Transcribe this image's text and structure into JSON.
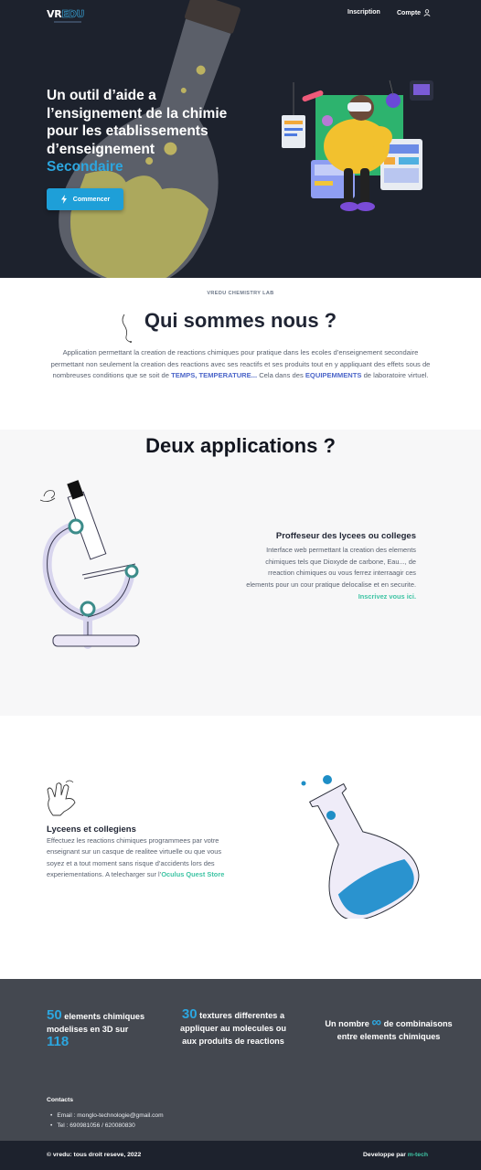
{
  "header": {
    "logo_vr": "VR",
    "logo_edu": "EDU",
    "nav": {
      "inscription": "Inscription",
      "compte": "Compte"
    }
  },
  "hero": {
    "title_line1": "Un outil d’aide a",
    "title_line2": "l’ensignement de la chimie",
    "title_line3": "pour les etablissements",
    "title_line4": "d’enseignement",
    "title_accent": "Secondaire",
    "cta_label": "Commencer"
  },
  "about": {
    "kicker": "VREDU  CHEMISTRY LAB",
    "title": "Qui sommes nous ?",
    "text_part1": "Application permettant la creation de reactions chimiques pour pratique dans les ecoles d’enseignement secondaire permettant non seulement la creation des reactions avec ses reactifs et ses produits tout en y appliquant des effets sous de nombreuses conditions que se soit de ",
    "kw1": "TEMPS",
    "sep": ", ",
    "kw2": "TEMPERATURE...",
    "text_part2": " Cela dans des ",
    "kw3": "EQUIPEMMENTS",
    "text_part3": " de laboratoire virtuel."
  },
  "apps": {
    "title": "Deux applications ?",
    "prof": {
      "title": "Proffeseur des lycees ou colleges",
      "text": "Interface web permettant la creation des elements chimiques tels que Dioxyde de carbone, Eau..., de rreaction chimiques ou vous ferrez interraagir ces elements  pour un cour pratique delocalise et en securite. ",
      "link": "Inscrivez vous ici."
    },
    "lyceens": {
      "title": "Lyceens et collegiens",
      "text": "Effectuez les reactions chimiques programmees par votre enseignant sur un casque de realitee virtuelle ou que vous soyez et a tout moment sans risque d’accidents lors des experiementations. A telecharger sur l’",
      "link": "Oculus Quest Store"
    }
  },
  "stats": {
    "s1_number": "50",
    "s1_text_a": " elements chimiques modelises en 3D sur ",
    "s1_number2": "118",
    "s2_number": "30",
    "s2_text": " textures differentes a appliquer au molecules ou aux produits de reactions",
    "s3_text_a": "Un nombre ",
    "s3_symbol": "∞",
    "s3_text_b": " de combinaisons entre elements chimiques"
  },
  "contacts": {
    "title": "Contacts",
    "email": "Email : monglo-technologie@gmail.com",
    "tel": "Tel : 690981056 / 620080830"
  },
  "footer": {
    "copyright": "© vredu: tous droit reseve, 2022",
    "dev_label": "Developpe par ",
    "dev_brand": "m-tech"
  },
  "colors": {
    "hero_bg": "#1d222d",
    "accent_blue": "#2ca6df",
    "accent_green": "#3ec4a4",
    "stats_bg": "#444850"
  },
  "icons": [
    "user-icon",
    "bolt-icon",
    "flask-icon",
    "microscope-icon",
    "hand-icon",
    "vr-character-illustration"
  ]
}
